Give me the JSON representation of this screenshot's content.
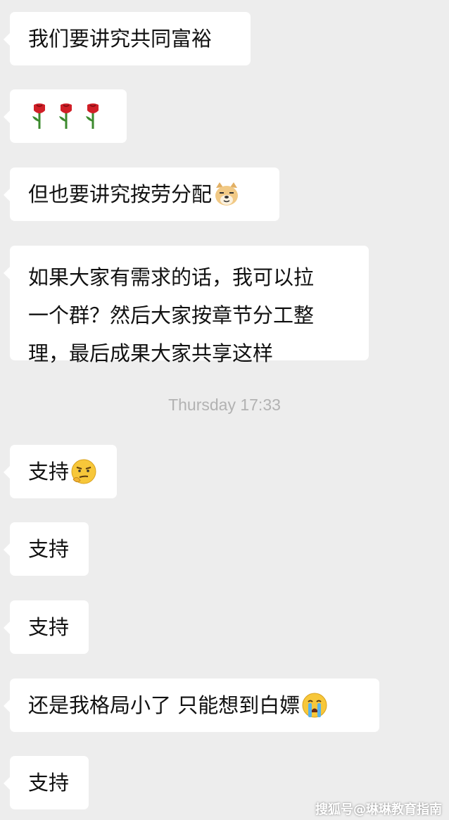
{
  "messages": [
    {
      "text": "我们要讲究共同富裕"
    },
    {
      "emoji": "rose-emoji"
    },
    {
      "text": "但也要讲究按劳分配",
      "emoji": "doge-emoji"
    },
    {
      "lines": [
        "如果大家有需求的话，我可以拉",
        "一个群？然后大家按章节分工整",
        "理，最后成果大家共享这样"
      ]
    },
    {
      "text": "支持",
      "emoji": "smirk-emoji"
    },
    {
      "text": "支持"
    },
    {
      "text": "支持"
    },
    {
      "text": "还是我格局小了 只能想到白嫖",
      "emoji": "crying-emoji"
    },
    {
      "text": "支持"
    }
  ],
  "timestamp": "Thursday 17:33",
  "watermark": "搜狐号@琳琳教育指南",
  "colors": {
    "background": "#ededed",
    "bubble": "#ffffff",
    "timestamp": "#b2b2b2"
  }
}
